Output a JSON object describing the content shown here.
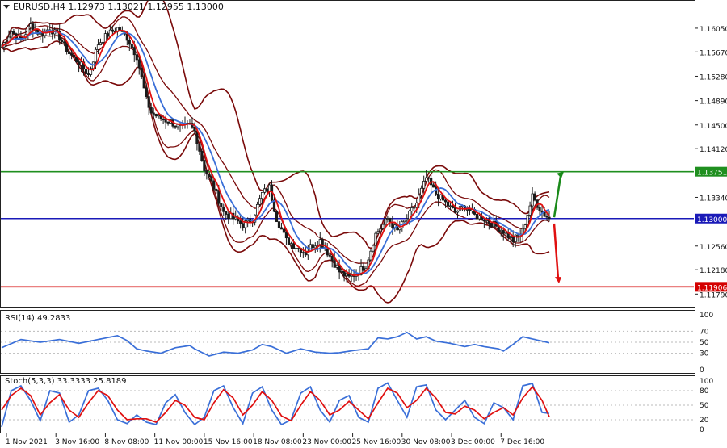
{
  "chart_data": {
    "type": "candlestick",
    "symbol_header": "EURUSD,H4  1.12973 1.13021 1.12955 1.13000",
    "colors": {
      "candle": "#1a1a1a",
      "bollinger": "#7a0a0a",
      "ma_fast": "#e01010",
      "ma_slow": "#3a6fd8",
      "level_resistance": "#1f8f1f",
      "level_pivot": "#1a1ab8",
      "level_support": "#d40000",
      "arrow_up": "#1a8a1a",
      "arrow_down": "#e01010"
    },
    "price_axis": {
      "range": [
        1.116,
        1.1645
      ],
      "ticks": [
        "1.16050",
        "1.15670",
        "1.15280",
        "1.14890",
        "1.14500",
        "1.14120",
        "1.13340",
        "1.12560",
        "1.12180",
        "1.11790"
      ]
    },
    "levels": [
      {
        "value": 1.13751,
        "label": "1.13751",
        "role": "resistance"
      },
      {
        "value": 1.13,
        "label": "1.13000",
        "role": "pivot"
      },
      {
        "value": 1.11906,
        "label": "1.11906",
        "role": "support"
      }
    ],
    "x_labels": [
      "1 Nov 2021",
      "3 Nov 16:00",
      "8 Nov 08:00",
      "11 Nov 00:00",
      "15 Nov 16:00",
      "18 Nov 08:00",
      "23 Nov 00:00",
      "25 Nov 16:00",
      "30 Nov 08:00",
      "3 Dec 00:00",
      "7 Dec 16:00"
    ],
    "close_path": [
      [
        0,
        1.1575
      ],
      [
        4,
        1.16
      ],
      [
        8,
        1.1585
      ],
      [
        12,
        1.161
      ],
      [
        16,
        1.1595
      ],
      [
        20,
        1.1605
      ],
      [
        24,
        1.159
      ],
      [
        28,
        1.1565
      ],
      [
        32,
        1.155
      ],
      [
        36,
        1.153
      ],
      [
        40,
        1.158
      ],
      [
        44,
        1.1595
      ],
      [
        48,
        1.1605
      ],
      [
        52,
        1.159
      ],
      [
        56,
        1.156
      ],
      [
        60,
        1.149
      ],
      [
        62,
        1.147
      ],
      [
        66,
        1.146
      ],
      [
        70,
        1.1455
      ],
      [
        74,
        1.1445
      ],
      [
        78,
        1.145
      ],
      [
        80,
        1.144
      ],
      [
        84,
        1.138
      ],
      [
        88,
        1.135
      ],
      [
        92,
        1.131
      ],
      [
        96,
        1.13
      ],
      [
        100,
        1.129
      ],
      [
        104,
        1.13
      ],
      [
        108,
        1.134
      ],
      [
        111,
        1.135
      ],
      [
        114,
        1.13
      ],
      [
        118,
        1.1265
      ],
      [
        122,
        1.1255
      ],
      [
        126,
        1.1245
      ],
      [
        128,
        1.1255
      ],
      [
        132,
        1.1265
      ],
      [
        136,
        1.124
      ],
      [
        140,
        1.1215
      ],
      [
        144,
        1.1205
      ],
      [
        148,
        1.1215
      ],
      [
        151,
        1.1225
      ],
      [
        155,
        1.1275
      ],
      [
        160,
        1.13
      ],
      [
        164,
        1.128
      ],
      [
        168,
        1.13
      ],
      [
        172,
        1.1325
      ],
      [
        176,
        1.1365
      ],
      [
        180,
        1.134
      ],
      [
        184,
        1.1325
      ],
      [
        188,
        1.131
      ],
      [
        192,
        1.132
      ],
      [
        196,
        1.1305
      ],
      [
        200,
        1.13
      ],
      [
        204,
        1.129
      ],
      [
        208,
        1.128
      ],
      [
        212,
        1.1265
      ],
      [
        216,
        1.128
      ],
      [
        220,
        1.1335
      ],
      [
        224,
        1.131
      ],
      [
        227,
        1.13
      ]
    ],
    "rsi": {
      "label": "RSI(14) 49.2833",
      "range": [
        0,
        100
      ],
      "ticks": [
        "100",
        "70",
        "50",
        "30",
        "0"
      ],
      "values": [
        [
          0,
          40
        ],
        [
          8,
          55
        ],
        [
          16,
          50
        ],
        [
          24,
          55
        ],
        [
          32,
          48
        ],
        [
          40,
          55
        ],
        [
          48,
          62
        ],
        [
          52,
          53
        ],
        [
          56,
          38
        ],
        [
          60,
          34
        ],
        [
          66,
          30
        ],
        [
          72,
          40
        ],
        [
          78,
          44
        ],
        [
          80,
          38
        ],
        [
          86,
          25
        ],
        [
          92,
          32
        ],
        [
          98,
          30
        ],
        [
          104,
          36
        ],
        [
          108,
          46
        ],
        [
          112,
          42
        ],
        [
          118,
          30
        ],
        [
          124,
          38
        ],
        [
          130,
          32
        ],
        [
          136,
          30
        ],
        [
          140,
          31
        ],
        [
          146,
          35
        ],
        [
          152,
          38
        ],
        [
          156,
          58
        ],
        [
          160,
          56
        ],
        [
          164,
          60
        ],
        [
          168,
          68
        ],
        [
          172,
          56
        ],
        [
          176,
          60
        ],
        [
          180,
          52
        ],
        [
          186,
          48
        ],
        [
          192,
          42
        ],
        [
          196,
          46
        ],
        [
          200,
          42
        ],
        [
          206,
          38
        ],
        [
          208,
          34
        ],
        [
          212,
          46
        ],
        [
          216,
          60
        ],
        [
          220,
          56
        ],
        [
          227,
          49
        ]
      ]
    },
    "stoch": {
      "label": "Stoch(5,3,3) 33.3333 25.8189",
      "range": [
        0,
        100
      ],
      "ticks": [
        "100",
        "80",
        "50",
        "20",
        "0"
      ],
      "k_values": [
        [
          0,
          5
        ],
        [
          4,
          80
        ],
        [
          8,
          90
        ],
        [
          12,
          60
        ],
        [
          16,
          18
        ],
        [
          20,
          80
        ],
        [
          24,
          75
        ],
        [
          28,
          15
        ],
        [
          32,
          30
        ],
        [
          36,
          80
        ],
        [
          40,
          85
        ],
        [
          44,
          60
        ],
        [
          48,
          20
        ],
        [
          52,
          12
        ],
        [
          56,
          30
        ],
        [
          60,
          15
        ],
        [
          64,
          10
        ],
        [
          68,
          55
        ],
        [
          72,
          72
        ],
        [
          76,
          35
        ],
        [
          80,
          10
        ],
        [
          84,
          25
        ],
        [
          88,
          80
        ],
        [
          92,
          90
        ],
        [
          96,
          45
        ],
        [
          100,
          12
        ],
        [
          104,
          75
        ],
        [
          108,
          88
        ],
        [
          112,
          40
        ],
        [
          116,
          10
        ],
        [
          120,
          20
        ],
        [
          124,
          75
        ],
        [
          128,
          88
        ],
        [
          132,
          40
        ],
        [
          136,
          15
        ],
        [
          140,
          60
        ],
        [
          144,
          70
        ],
        [
          148,
          25
        ],
        [
          152,
          15
        ],
        [
          156,
          85
        ],
        [
          160,
          96
        ],
        [
          164,
          60
        ],
        [
          168,
          25
        ],
        [
          172,
          88
        ],
        [
          176,
          92
        ],
        [
          180,
          40
        ],
        [
          184,
          20
        ],
        [
          188,
          40
        ],
        [
          192,
          60
        ],
        [
          196,
          25
        ],
        [
          200,
          12
        ],
        [
          204,
          55
        ],
        [
          208,
          45
        ],
        [
          212,
          20
        ],
        [
          216,
          90
        ],
        [
          220,
          95
        ],
        [
          224,
          35
        ],
        [
          227,
          33
        ]
      ],
      "d_values": [
        [
          0,
          40
        ],
        [
          4,
          70
        ],
        [
          8,
          85
        ],
        [
          12,
          70
        ],
        [
          16,
          30
        ],
        [
          20,
          55
        ],
        [
          24,
          72
        ],
        [
          28,
          40
        ],
        [
          32,
          25
        ],
        [
          36,
          55
        ],
        [
          40,
          80
        ],
        [
          44,
          70
        ],
        [
          48,
          40
        ],
        [
          52,
          20
        ],
        [
          56,
          22
        ],
        [
          60,
          22
        ],
        [
          64,
          15
        ],
        [
          68,
          35
        ],
        [
          72,
          60
        ],
        [
          76,
          50
        ],
        [
          80,
          25
        ],
        [
          84,
          20
        ],
        [
          88,
          55
        ],
        [
          92,
          82
        ],
        [
          96,
          65
        ],
        [
          100,
          30
        ],
        [
          104,
          50
        ],
        [
          108,
          78
        ],
        [
          112,
          60
        ],
        [
          116,
          28
        ],
        [
          120,
          18
        ],
        [
          124,
          50
        ],
        [
          128,
          78
        ],
        [
          132,
          60
        ],
        [
          136,
          30
        ],
        [
          140,
          40
        ],
        [
          144,
          58
        ],
        [
          148,
          40
        ],
        [
          152,
          22
        ],
        [
          156,
          55
        ],
        [
          160,
          85
        ],
        [
          164,
          75
        ],
        [
          168,
          45
        ],
        [
          172,
          60
        ],
        [
          176,
          85
        ],
        [
          180,
          65
        ],
        [
          184,
          35
        ],
        [
          188,
          32
        ],
        [
          192,
          48
        ],
        [
          196,
          40
        ],
        [
          200,
          22
        ],
        [
          204,
          35
        ],
        [
          208,
          45
        ],
        [
          212,
          30
        ],
        [
          216,
          65
        ],
        [
          220,
          88
        ],
        [
          224,
          60
        ],
        [
          227,
          26
        ]
      ]
    }
  }
}
